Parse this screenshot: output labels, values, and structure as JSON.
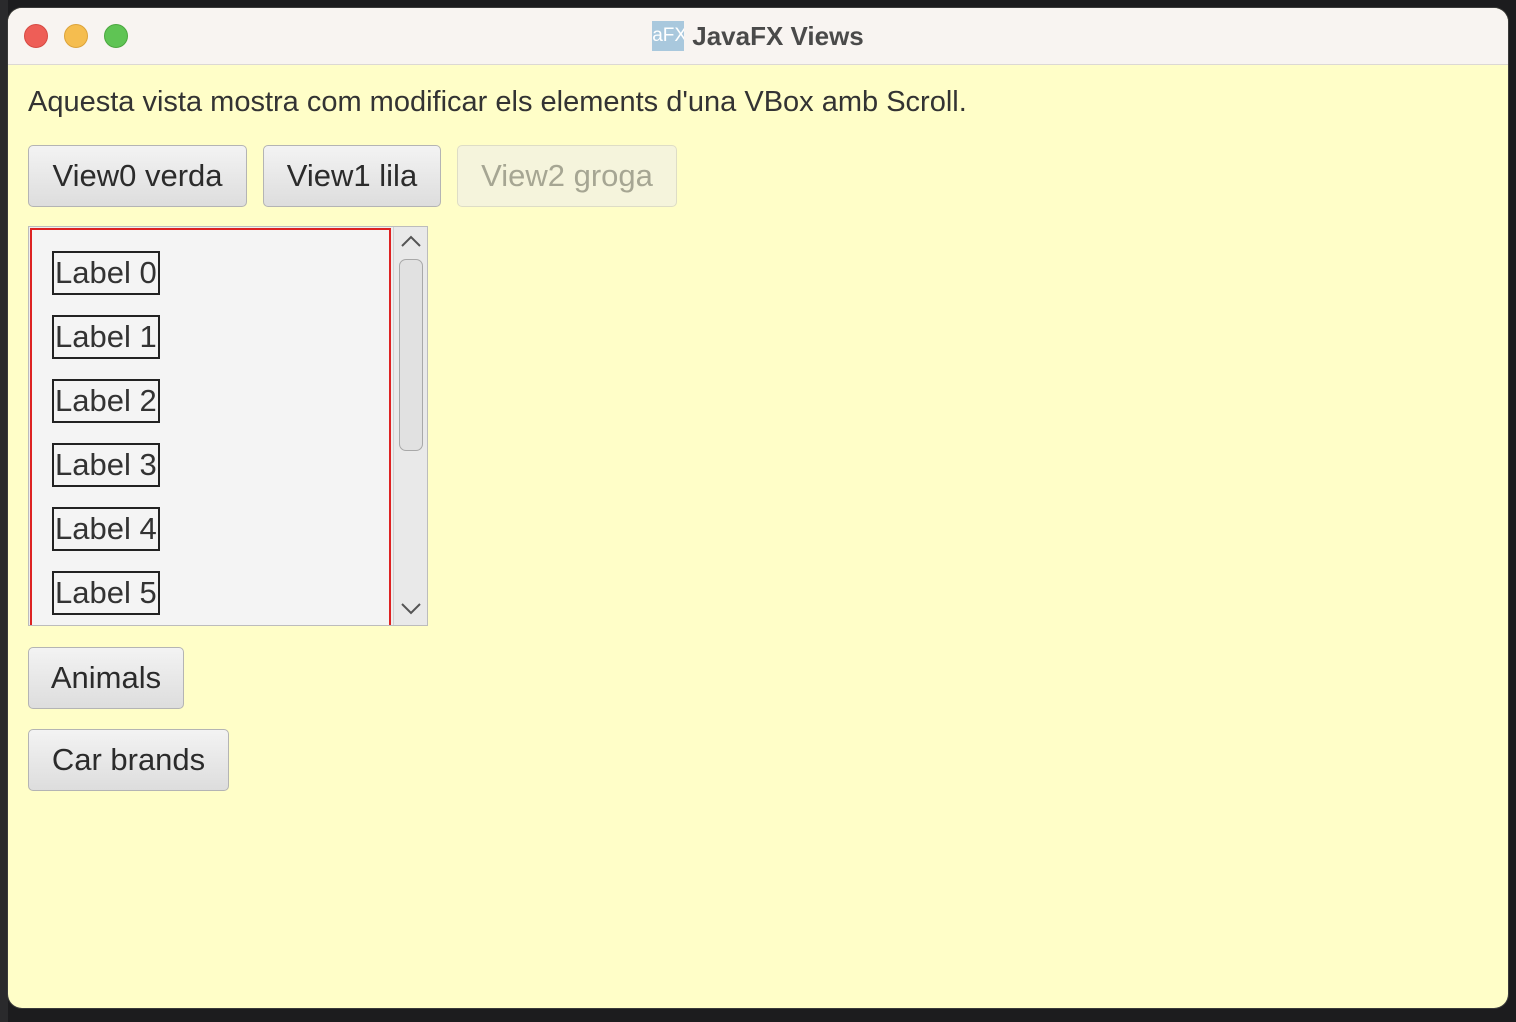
{
  "window": {
    "title": "JavaFX Views",
    "app_icon_text": "aFX"
  },
  "main": {
    "description": "Aquesta vista mostra com modificar els elements d'una VBox amb Scroll.",
    "view_buttons": [
      {
        "label": "View0 verda",
        "enabled": true
      },
      {
        "label": "View1 lila",
        "enabled": true
      },
      {
        "label": "View2 groga",
        "enabled": false
      }
    ],
    "scroll_labels": [
      "Label 0",
      "Label 1",
      "Label 2",
      "Label 3",
      "Label 4",
      "Label 5"
    ],
    "animals_button": "Animals",
    "car_brands_button": "Car brands"
  },
  "colors": {
    "window_background": "#fffec8",
    "vbox_border": "#dd2222",
    "titlebar": "#f8f4f1"
  },
  "icons": [
    "close-icon",
    "minimize-icon",
    "maximize-icon",
    "chevron-up-icon",
    "chevron-down-icon"
  ]
}
